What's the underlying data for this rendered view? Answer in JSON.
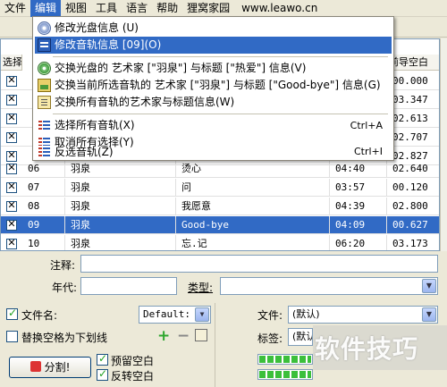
{
  "menubar": {
    "items": [
      "文件",
      "编辑",
      "视图",
      "工具",
      "语言",
      "帮助",
      "狸窝家园"
    ],
    "site": "www.leawo.cn",
    "active_index": 1
  },
  "edit_menu": {
    "items": [
      {
        "label": "修改光盘信息 (U)",
        "shortcut": "",
        "icon": "disc-icon",
        "highlighted": false
      },
      {
        "label": "修改音轨信息 [09](O)",
        "shortcut": "",
        "icon": "track-icon",
        "highlighted": true
      },
      {
        "label": "交换光盘的 艺术家 [\"羽泉\"] 与标题 [\"热爱\"] 信息(V)",
        "shortcut": "",
        "icon": "disc-swap-icon",
        "highlighted": false
      },
      {
        "label": "交换当前所选音轨的 艺术家 [\"羽泉\"] 与标题 [\"Good-bye\"] 信息(G)",
        "shortcut": "",
        "icon": "image-swap-icon",
        "highlighted": false
      },
      {
        "label": "交换所有音轨的艺术家与标题信息(W)",
        "shortcut": "",
        "icon": "notes-swap-icon",
        "highlighted": false
      },
      {
        "label": "选择所有音轨(X)",
        "shortcut": "Ctrl+A",
        "icon": "select-all-icon",
        "highlighted": false
      },
      {
        "label": "取消所有选择(Y)",
        "shortcut": "",
        "icon": "deselect-all-icon",
        "highlighted": false
      },
      {
        "label": "反选音轨(Z)",
        "shortcut": "Ctrl+I",
        "icon": "invert-selection-icon",
        "highlighted": false
      }
    ]
  },
  "grid": {
    "left_header": "选择",
    "right_header": "前导空白",
    "rows_visible_partial": [
      {
        "checked": true,
        "gap": "00.000"
      },
      {
        "checked": true,
        "gap": "03.347"
      },
      {
        "checked": true,
        "gap": "02.613"
      },
      {
        "checked": true,
        "gap": "02.707"
      },
      {
        "checked": true,
        "gap": "02.827"
      }
    ],
    "rows": [
      {
        "checked": true,
        "no": "06",
        "artist": "羽泉",
        "title": "烫心",
        "time": "04:40",
        "gap": "02.640",
        "selected": false
      },
      {
        "checked": true,
        "no": "07",
        "artist": "羽泉",
        "title": "问",
        "time": "03:57",
        "gap": "00.120",
        "selected": false
      },
      {
        "checked": true,
        "no": "08",
        "artist": "羽泉",
        "title": "我愿意",
        "time": "04:39",
        "gap": "02.800",
        "selected": false
      },
      {
        "checked": true,
        "no": "09",
        "artist": "羽泉",
        "title": "Good-bye",
        "time": "04:09",
        "gap": "00.627",
        "selected": true
      },
      {
        "checked": true,
        "no": "10",
        "artist": "羽泉",
        "title": "忘.记",
        "time": "06:20",
        "gap": "03.173",
        "selected": false
      }
    ]
  },
  "form": {
    "comment_label": "注释:",
    "comment_value": "",
    "year_label": "年代:",
    "year_value": "",
    "genre_label": "类型:",
    "genre_value": "",
    "filename_label": "文件名:",
    "filename_checked": true,
    "filename_format": "Default:",
    "replace_space_label": "替换空格为下划线",
    "replace_space_checked": false,
    "file_label": "文件:",
    "file_value": "(默认)",
    "tag_label": "标签:",
    "tag_value": "(默认"
  },
  "actions": {
    "split_label": "分割!",
    "keep_gap_label": "预留空白",
    "keep_gap_checked": true,
    "reverse_gap_label": "反转空白",
    "reverse_gap_checked": true
  },
  "progress": {
    "bar1": 1.0,
    "bar2": 1.0
  },
  "watermark": "软件技巧",
  "colors": {
    "highlight": "#316ac5",
    "window": "#ece9d8",
    "progress": "#3bbf3b"
  }
}
